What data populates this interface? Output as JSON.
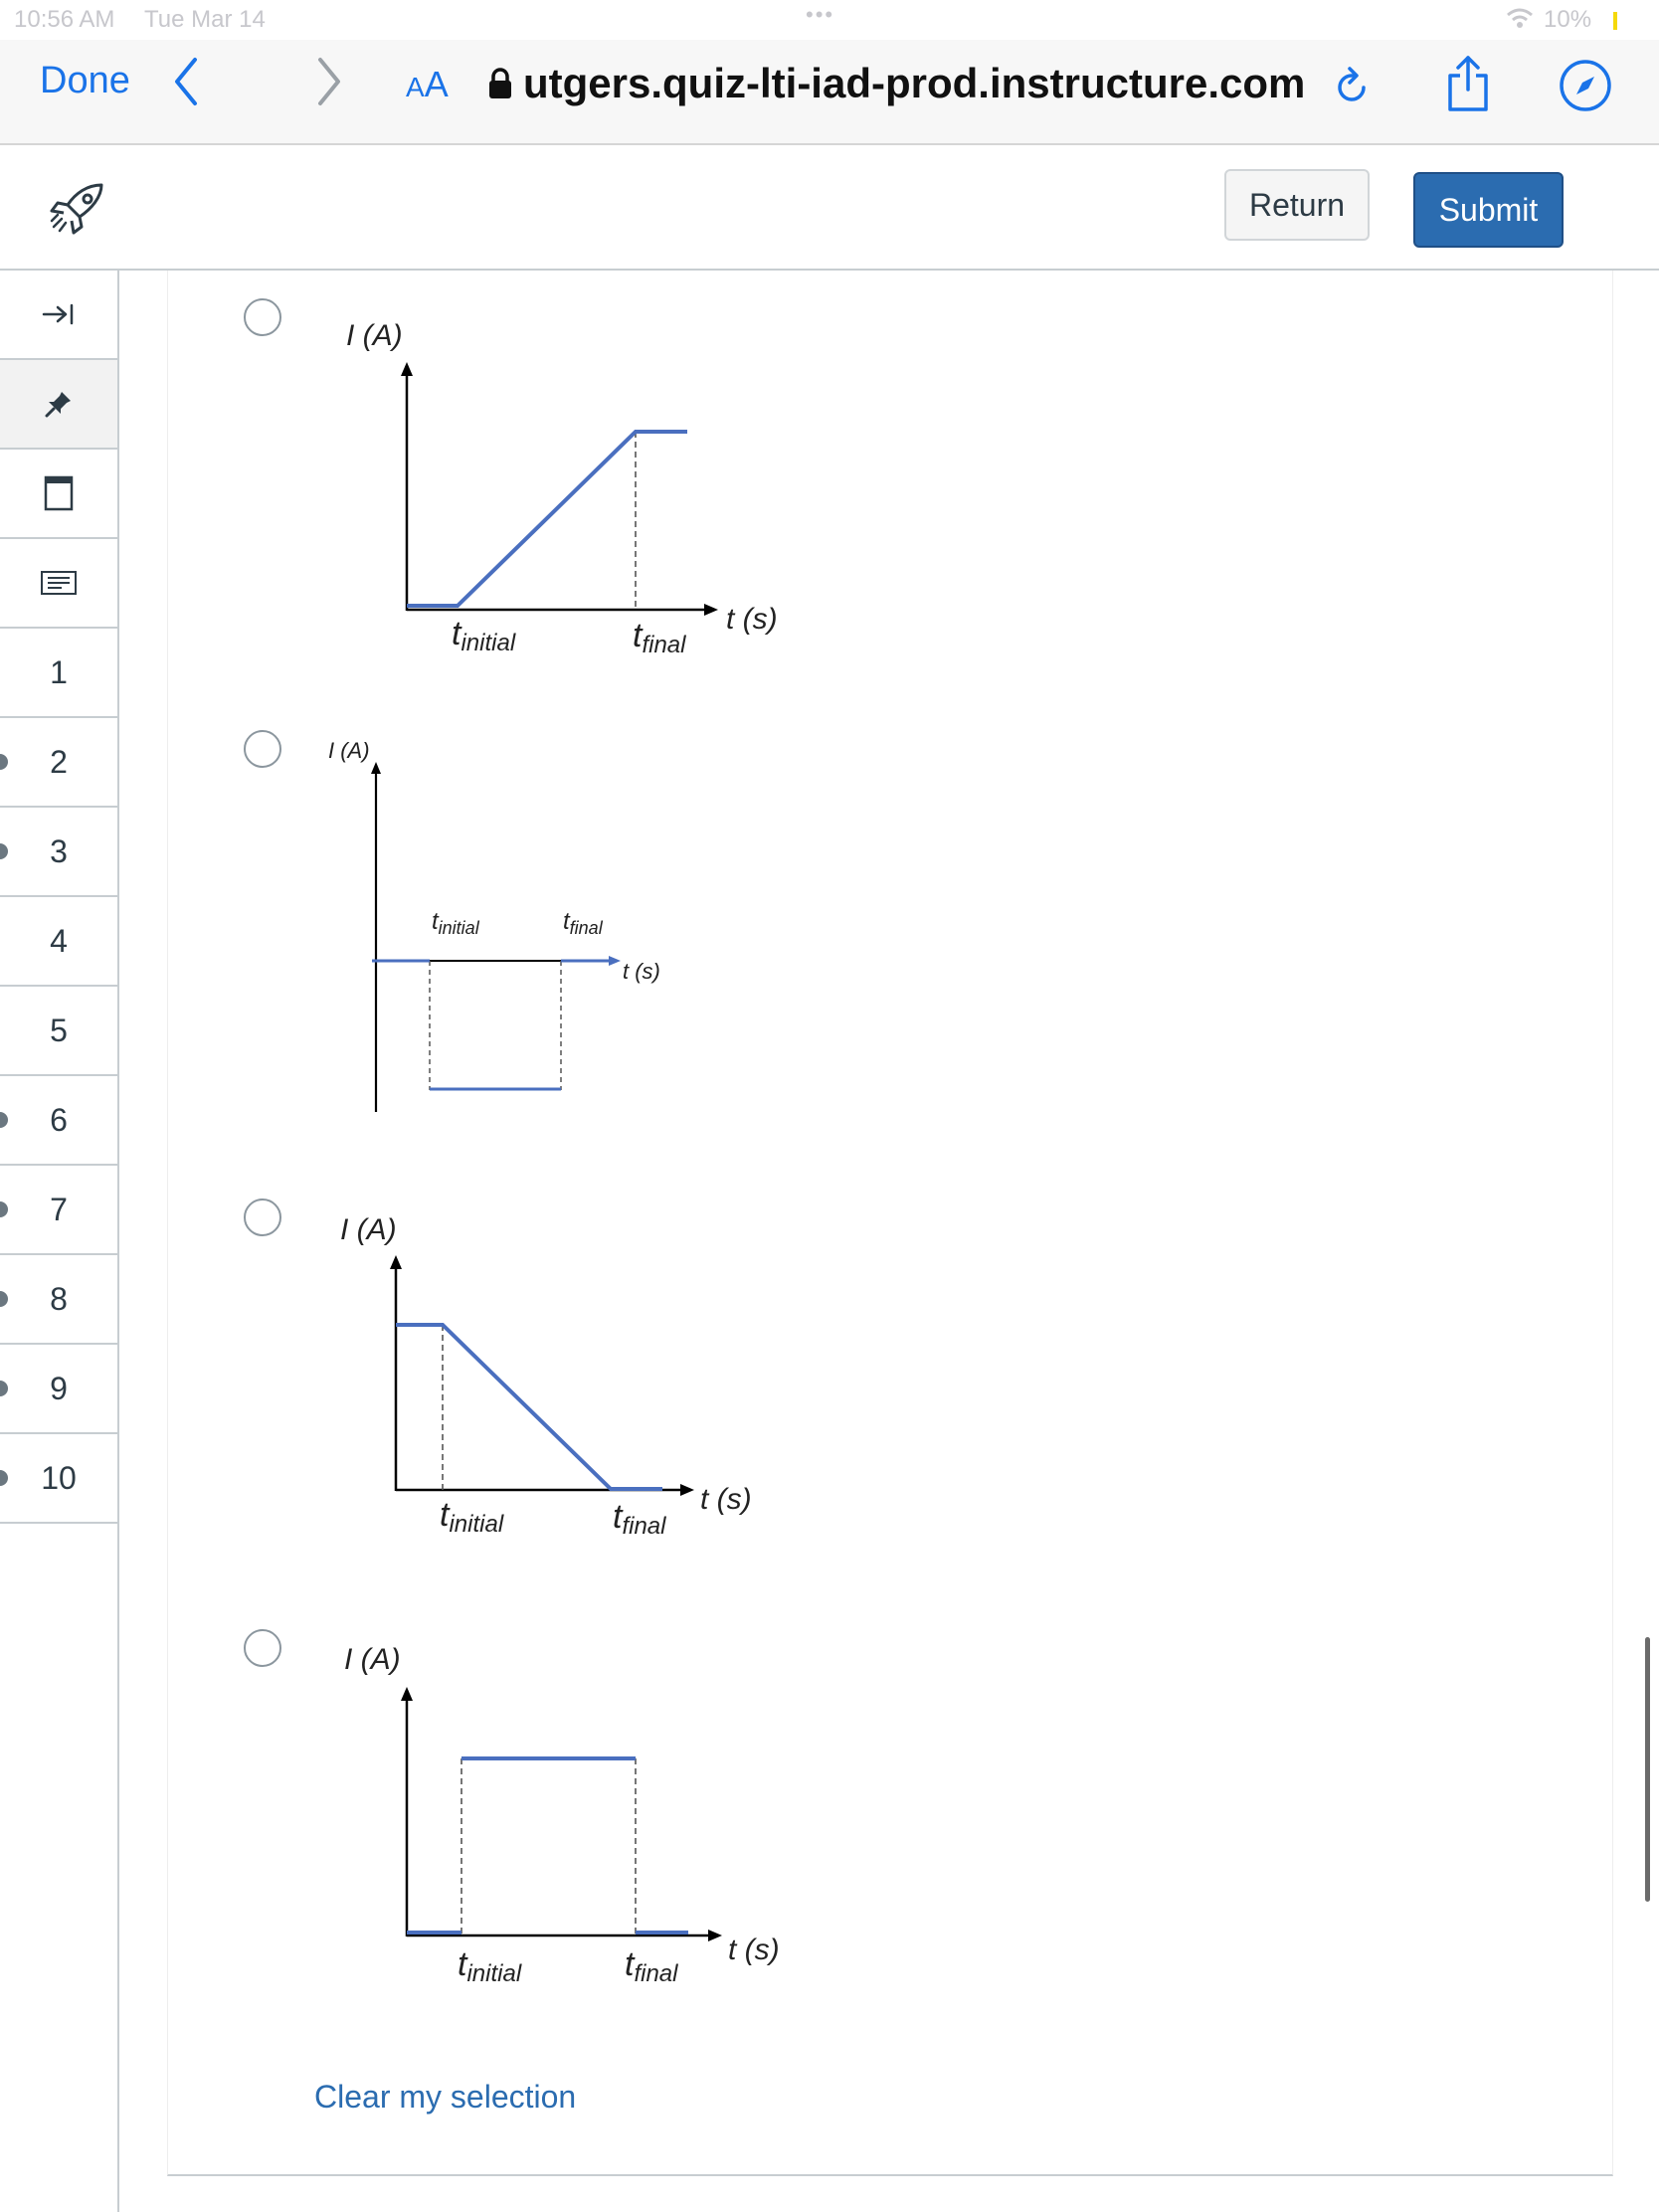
{
  "status_bar": {
    "time": "10:56 AM",
    "date": "Tue Mar 14",
    "dots": "•••",
    "battery": "10%"
  },
  "browser": {
    "done_label": "Done",
    "aa_small": "A",
    "aa_large": "A",
    "url": "utgers.quiz-lti-iad-prod.instructure.com"
  },
  "header": {
    "return_label": "Return",
    "submit_label": "Submit"
  },
  "sidebar": {
    "numbers": [
      "1",
      "2",
      "3",
      "4",
      "5",
      "6",
      "7",
      "8",
      "9",
      "10"
    ]
  },
  "options": [
    {
      "y_label": "I (A)",
      "x_label": "t (s)",
      "t_initial": "t",
      "t_initial_sub": "initial",
      "t_final": "t",
      "t_final_sub": "final"
    },
    {
      "y_label": "I (A)",
      "x_label": "t (s)",
      "t_initial": "t",
      "t_initial_sub": "initial",
      "t_final": "t",
      "t_final_sub": "final"
    },
    {
      "y_label": "I (A)",
      "x_label": "t (s)",
      "t_initial": "t",
      "t_initial_sub": "initial",
      "t_final": "t",
      "t_final_sub": "final"
    },
    {
      "y_label": "I (A)",
      "x_label": "t (s)",
      "t_initial": "t",
      "t_initial_sub": "initial",
      "t_final": "t",
      "t_final_sub": "final"
    }
  ],
  "clear_label": "Clear my selection",
  "colors": {
    "accent": "#1a73e8",
    "submit": "#2b6cb0",
    "curve": "#4a6fbf"
  }
}
